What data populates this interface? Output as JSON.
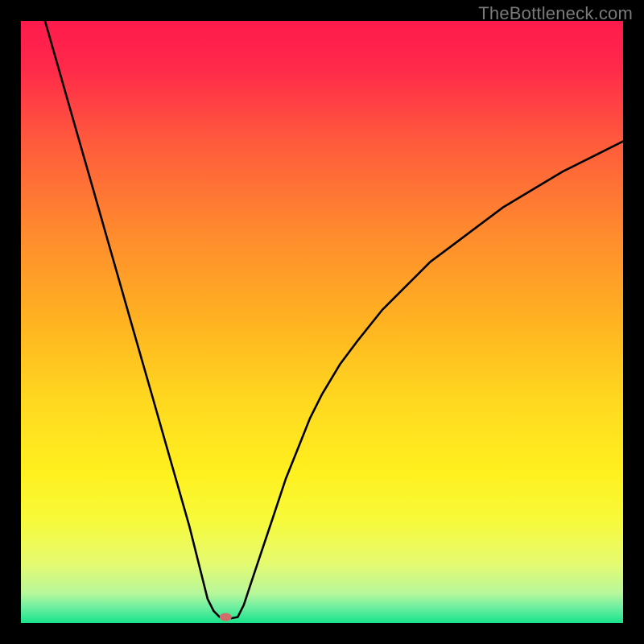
{
  "watermark": "TheBottleneck.com",
  "colors": {
    "frame": "#000000",
    "curve": "#000000",
    "marker": "#d16d6a",
    "gradient_stops": [
      {
        "offset": 0.0,
        "color": "#ff1a4d"
      },
      {
        "offset": 0.08,
        "color": "#ff2a4a"
      },
      {
        "offset": 0.2,
        "color": "#ff5a3c"
      },
      {
        "offset": 0.35,
        "color": "#ff8a2e"
      },
      {
        "offset": 0.5,
        "color": "#ffb321"
      },
      {
        "offset": 0.63,
        "color": "#ffd81f"
      },
      {
        "offset": 0.75,
        "color": "#fff01f"
      },
      {
        "offset": 0.83,
        "color": "#f7fa3a"
      },
      {
        "offset": 0.9,
        "color": "#e6fa70"
      },
      {
        "offset": 0.95,
        "color": "#b8f79a"
      },
      {
        "offset": 0.975,
        "color": "#6aeea0"
      },
      {
        "offset": 1.0,
        "color": "#17e38a"
      }
    ]
  },
  "chart_data": {
    "type": "line",
    "title": "",
    "xlabel": "",
    "ylabel": "",
    "xlim": [
      0,
      100
    ],
    "ylim": [
      0,
      100
    ],
    "marker": {
      "x": 34,
      "y": 1
    },
    "series": [
      {
        "name": "left-branch",
        "x": [
          4,
          6,
          8,
          10,
          12,
          14,
          16,
          18,
          20,
          22,
          24,
          26,
          28,
          30,
          31,
          32,
          33
        ],
        "y": [
          100,
          93,
          86,
          79,
          72,
          65,
          58,
          51,
          44,
          37,
          30,
          23,
          16,
          8,
          4,
          2,
          1
        ]
      },
      {
        "name": "bottom-flat",
        "x": [
          33,
          34,
          35,
          36
        ],
        "y": [
          1,
          0.8,
          0.8,
          1
        ]
      },
      {
        "name": "right-branch",
        "x": [
          36,
          37,
          38,
          40,
          42,
          44,
          46,
          48,
          50,
          53,
          56,
          60,
          64,
          68,
          72,
          76,
          80,
          85,
          90,
          95,
          100
        ],
        "y": [
          1,
          3,
          6,
          12,
          18,
          24,
          29,
          34,
          38,
          43,
          47,
          52,
          56,
          60,
          63,
          66,
          69,
          72,
          75,
          77.5,
          80
        ]
      }
    ]
  }
}
